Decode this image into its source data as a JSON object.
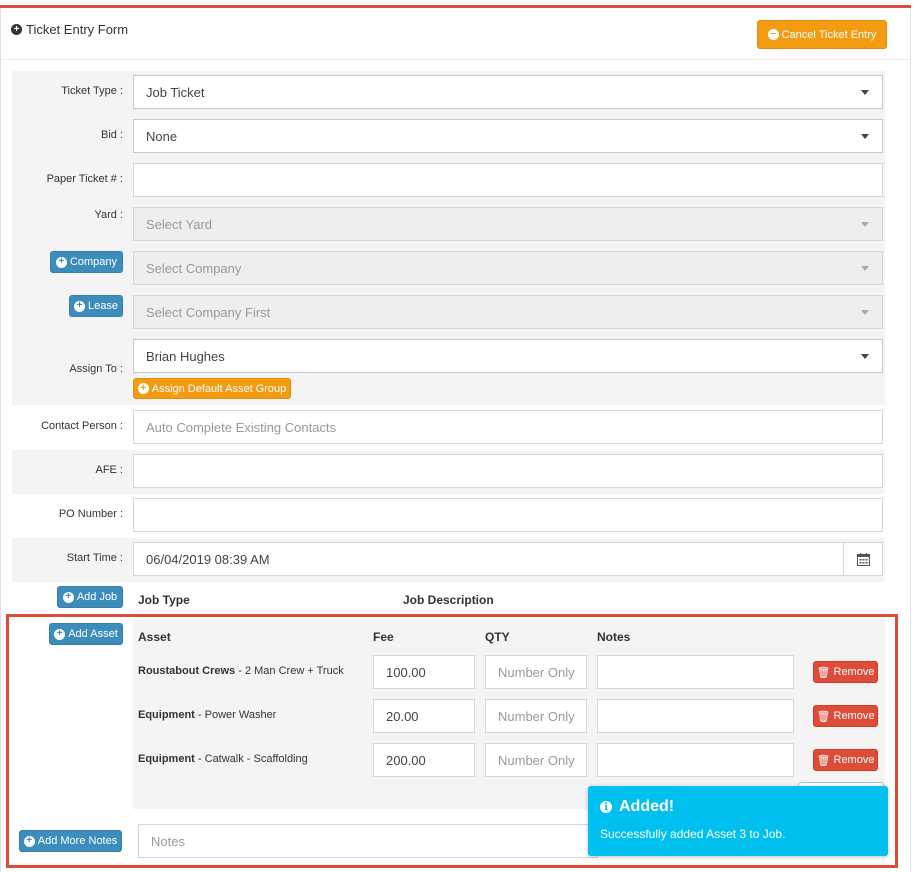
{
  "header": {
    "title": "Ticket Entry Form",
    "cancel_label": "Cancel Ticket Entry"
  },
  "form": {
    "ticket_type": {
      "label": "Ticket Type :",
      "value": "Job Ticket"
    },
    "bid": {
      "label": "Bid :",
      "value": "None"
    },
    "paper_ticket": {
      "label": "Paper Ticket # :",
      "value": ""
    },
    "yard": {
      "label": "Yard :",
      "placeholder": "Select Yard"
    },
    "company": {
      "button_label": "Company",
      "placeholder": "Select Company"
    },
    "lease": {
      "button_label": "Lease",
      "placeholder": "Select Company First"
    },
    "assign_to": {
      "label": "Assign To :",
      "value": "Brian Hughes",
      "button_label": "Assign Default Asset Group"
    },
    "contact_person": {
      "label": "Contact Person :",
      "placeholder": "Auto Complete Existing Contacts"
    },
    "afe": {
      "label": "AFE :",
      "value": ""
    },
    "po_number": {
      "label": "PO Number :",
      "value": ""
    },
    "start_time": {
      "label": "Start Time :",
      "value": "06/04/2019 08:39 AM"
    }
  },
  "jobs": {
    "add_job_label": "Add Job",
    "col_job_type": "Job Type",
    "col_job_description": "Job Description"
  },
  "assets": {
    "add_asset_label": "Add Asset",
    "col_asset": "Asset",
    "col_fee": "Fee",
    "col_qty": "QTY",
    "col_notes": "Notes",
    "qty_placeholder": "Number Only",
    "remove_label": "Remove",
    "rows": [
      {
        "category": "Roustabout Crews",
        "name": " - 2 Man Crew + Truck",
        "fee": "100.00"
      },
      {
        "category": "Equipment",
        "name": " - Power Washer",
        "fee": "20.00"
      },
      {
        "category": "Equipment",
        "name": " - Catwalk - Scaffolding",
        "fee": "200.00"
      }
    ]
  },
  "notes": {
    "add_more_label": "Add More Notes",
    "placeholder": "Notes"
  },
  "toast": {
    "title": "Added!",
    "message": "Successfully added Asset 3 to Job."
  },
  "colors": {
    "danger": "#dd4b39",
    "warning": "#f39c12",
    "primary": "#3c8dbc",
    "info": "#00c0ef"
  }
}
